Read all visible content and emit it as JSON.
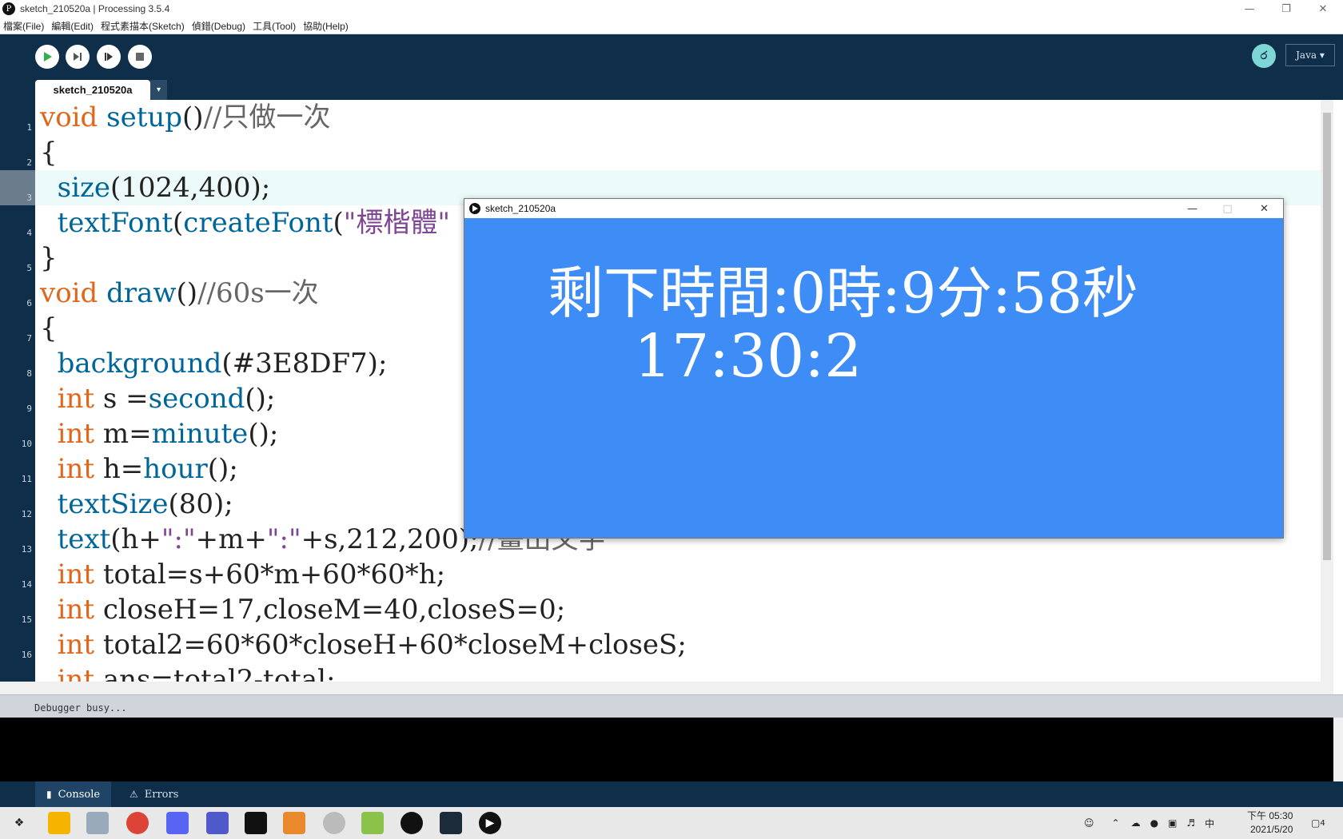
{
  "window": {
    "title": "sketch_210520a | Processing 3.5.4",
    "app_icon": "P"
  },
  "menu": [
    "檔案(File)",
    "編輯(Edit)",
    "程式素描本(Sketch)",
    "偵錯(Debug)",
    "工具(Tool)",
    "協助(Help)"
  ],
  "toolbar": {
    "mode": "Java ▾",
    "debug_icon": "butterfly-icon"
  },
  "tab": {
    "name": "sketch_210520a",
    "menu_glyph": "▾"
  },
  "editor": {
    "line_numbers": [
      "1",
      "2",
      "3",
      "4",
      "5",
      "6",
      "7",
      "8",
      "9",
      "10",
      "11",
      "12",
      "13",
      "14",
      "15",
      "16"
    ],
    "current_line": 3
  },
  "status": {
    "message": "Debugger busy..."
  },
  "footer": {
    "console_label": "Console",
    "errors_label": "Errors"
  },
  "sketch_window": {
    "title": "sketch_210520a",
    "line1": "剩下時間:0時:9分:58秒",
    "line2": "17:30:2",
    "background": "#3E8DF7"
  },
  "taskbar": {
    "time": "下午 05:30",
    "date": "2021/5/20",
    "ime": "中",
    "notification_count": "4"
  }
}
